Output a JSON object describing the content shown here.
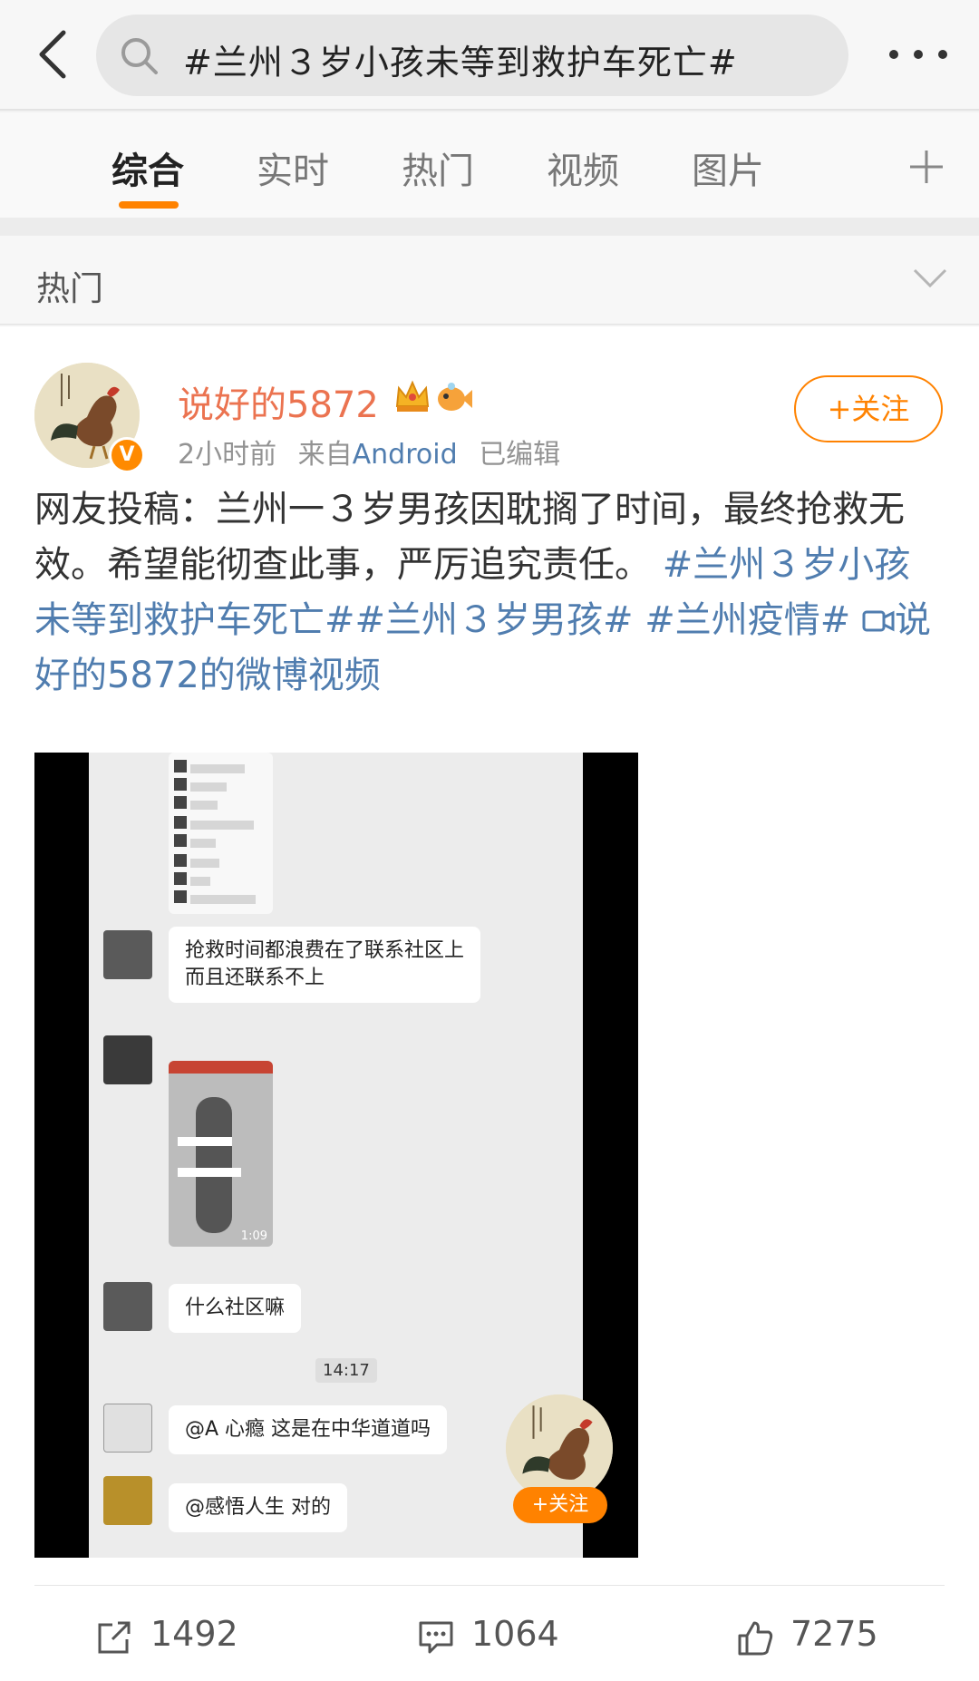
{
  "header": {
    "search_text": "#兰州３岁小孩未等到救护车死亡#"
  },
  "tabs": [
    "综合",
    "实时",
    "热门",
    "视频",
    "图片"
  ],
  "section": {
    "label": "热门"
  },
  "post": {
    "username": "说好的5872",
    "verified_badge": "V",
    "time": "2小时前",
    "from_prefix": "来自",
    "source": "Android",
    "edited": "已编辑",
    "follow_label": "+关注",
    "text_plain": "网友投稿：兰州一３岁男孩因耽搁了时间，最终抢救无效。希望能彻查此事，严厉追究责任。",
    "tag1": "#兰州３岁小孩未等到救护车死亡#",
    "tag2": "#兰州３岁男孩#",
    "tag3": "#兰州疫情#",
    "video_link": "说好的5872的微博视频"
  },
  "video": {
    "bubble1_line1": "抢救时间都浪费在了联系社区上",
    "bubble1_line2": "而且还联系不上",
    "bubble2": "什么社区嘛",
    "chat_time": "14:17",
    "bubble3": "@A 心瘾  这是在中华道道吗",
    "bubble4": "@感悟人生  对的",
    "photo_duration": "1:09",
    "float_follow": "+关注"
  },
  "actions": {
    "repost_count": "1492",
    "comment_count": "1064",
    "like_count": "7275"
  },
  "colors": {
    "accent": "#ff8200",
    "username": "#eb7350",
    "link": "#507daf"
  }
}
